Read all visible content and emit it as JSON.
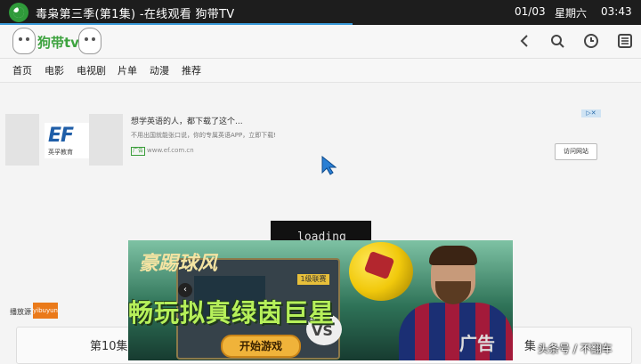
{
  "titlebar": {
    "title": "毒枭第三季(第1集) -在线观看 狗带TV",
    "date": "01/03",
    "weekday": "星期六",
    "time": "03:43",
    "load_progress_percent": 55
  },
  "site": {
    "logo_text": "狗带tv"
  },
  "nav": {
    "items": [
      "首页",
      "电影",
      "电视剧",
      "片单",
      "动漫",
      "推荐"
    ]
  },
  "ad": {
    "logo": "EF",
    "logo_sub": "英孚教育",
    "headline": "想学英语的人，都下载了这个...",
    "description": "不用出国就能张口说，你的专属英语APP，立即下载!",
    "url_badge": "广告",
    "url": "www.ef.com.cn",
    "visit_button": "访问网站"
  },
  "player": {
    "loading_text": "loading"
  },
  "source": {
    "label": "播放源",
    "selected": "yibuyun"
  },
  "episodes": {
    "items": [
      "第10集",
      "集"
    ]
  },
  "game_ad": {
    "calligraphy": "豪踢球风",
    "pill": "1级联赛",
    "headline": "畅玩拟真绿茵巨星",
    "start_button": "开始游戏",
    "vs": "VS",
    "ad_label": "广告"
  },
  "watermark": "头条号 / 不翻车",
  "colors": {
    "accent_green": "#3da33f",
    "source_badge": "#ea7a1a",
    "progress": "#3a9ad9"
  }
}
